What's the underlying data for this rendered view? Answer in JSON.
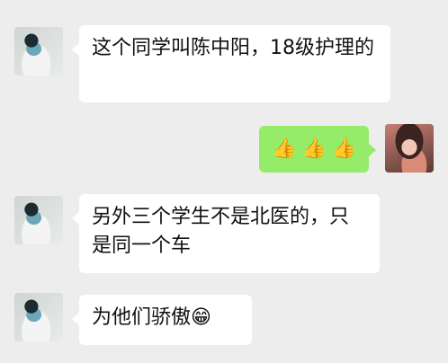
{
  "messages": [
    {
      "side": "left",
      "text": "这个同学叫陈中阳，18级护理的"
    },
    {
      "side": "right",
      "emojis": [
        "👍",
        "👍",
        "👍"
      ]
    },
    {
      "side": "left",
      "text": "另外三个学生不是北医的，只是同一个车"
    },
    {
      "side": "left",
      "text": "为他们骄傲",
      "emoji": "😁"
    }
  ],
  "icons": {
    "thumbs_up": "thumbs-up-icon",
    "grin": "grinning-face-icon"
  },
  "colors": {
    "background": "#ededed",
    "bubble_incoming": "#ffffff",
    "bubble_outgoing": "#95ec69"
  }
}
